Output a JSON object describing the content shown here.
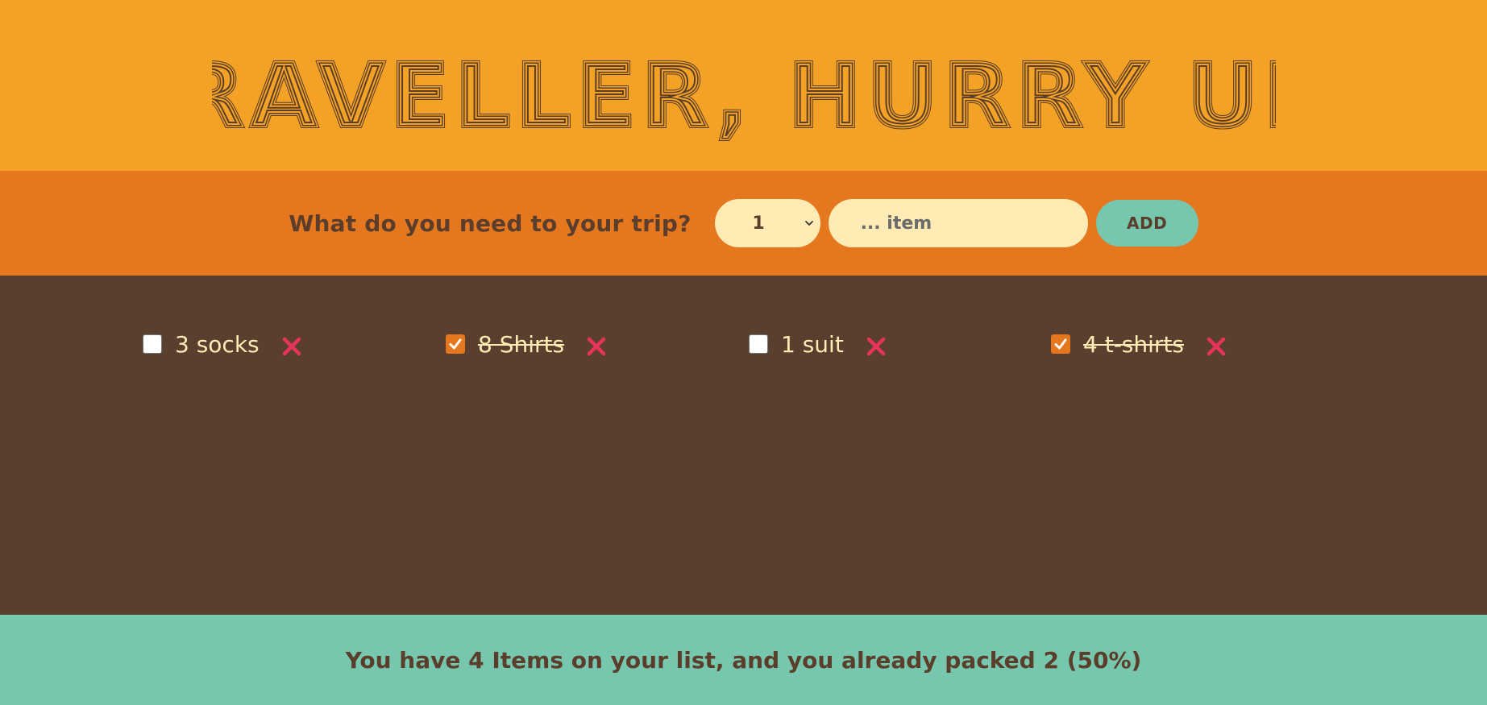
{
  "header": {
    "title": "TRAVELLER, HURRY UP!"
  },
  "form": {
    "question": "What do you need to your trip?",
    "quantity_value": "1",
    "item_placeholder": "... item",
    "add_label": "ADD"
  },
  "items": [
    {
      "label": "3 socks",
      "packed": false
    },
    {
      "label": "8 Shirts",
      "packed": true
    },
    {
      "label": "1 suit",
      "packed": false
    },
    {
      "label": "4 t-shirts",
      "packed": true
    }
  ],
  "footer": {
    "stats": "You have 4 Items on your list, and you already packed 2 (50%)"
  },
  "colors": {
    "header_bg": "#f4a226",
    "form_bg": "#e5771f",
    "list_bg": "#5a3e2e",
    "footer_bg": "#76c7ad",
    "text_dark": "#5a3e2b",
    "text_light": "#ffebb3",
    "remove_red": "#e5335a"
  }
}
